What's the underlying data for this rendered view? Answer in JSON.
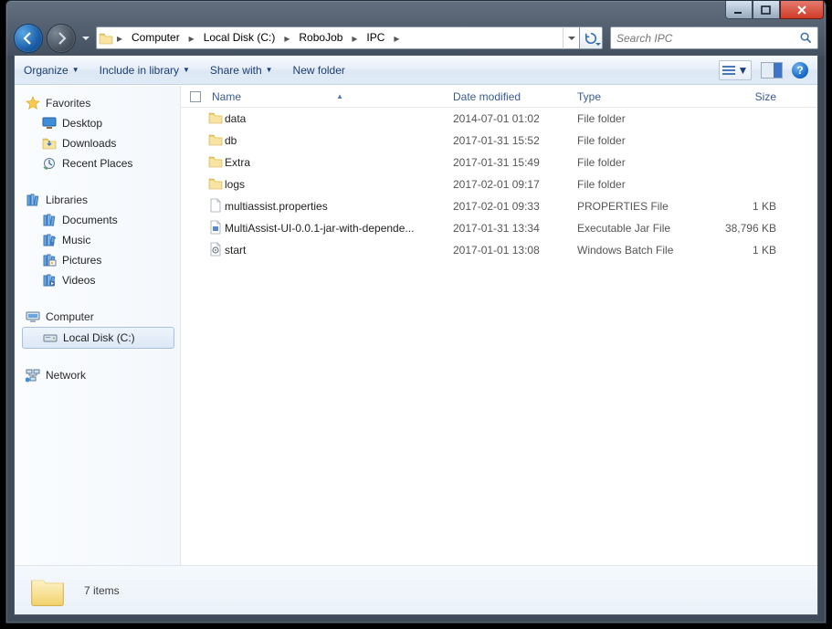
{
  "window": {
    "min_tip": "Minimize",
    "max_tip": "Maximize",
    "close_tip": "Close"
  },
  "nav": {
    "back_tip": "Back",
    "forward_tip": "Forward"
  },
  "breadcrumbs": [
    "Computer",
    "Local Disk (C:)",
    "RoboJob",
    "IPC"
  ],
  "search": {
    "placeholder": "Search IPC"
  },
  "toolbar": {
    "organize": "Organize",
    "include": "Include in library",
    "share": "Share with",
    "new_folder": "New folder"
  },
  "sidebar": {
    "favorites": {
      "label": "Favorites",
      "items": [
        "Desktop",
        "Downloads",
        "Recent Places"
      ]
    },
    "libraries": {
      "label": "Libraries",
      "items": [
        "Documents",
        "Music",
        "Pictures",
        "Videos"
      ]
    },
    "computer": {
      "label": "Computer",
      "items": [
        "Local Disk (C:)"
      ]
    },
    "network": {
      "label": "Network"
    }
  },
  "columns": {
    "name": "Name",
    "date": "Date modified",
    "type": "Type",
    "size": "Size"
  },
  "files": [
    {
      "icon": "folder",
      "name": "data",
      "date": "2014-07-01 01:02",
      "type": "File folder",
      "size": ""
    },
    {
      "icon": "folder",
      "name": "db",
      "date": "2017-01-31 15:52",
      "type": "File folder",
      "size": ""
    },
    {
      "icon": "folder",
      "name": "Extra",
      "date": "2017-01-31 15:49",
      "type": "File folder",
      "size": ""
    },
    {
      "icon": "folder",
      "name": "logs",
      "date": "2017-02-01 09:17",
      "type": "File folder",
      "size": ""
    },
    {
      "icon": "file",
      "name": "multiassist.properties",
      "date": "2017-02-01 09:33",
      "type": "PROPERTIES File",
      "size": "1 KB"
    },
    {
      "icon": "jar",
      "name": "MultiAssist-UI-0.0.1-jar-with-depende...",
      "date": "2017-01-31 13:34",
      "type": "Executable Jar File",
      "size": "38,796 KB"
    },
    {
      "icon": "batch",
      "name": "start",
      "date": "2017-01-01 13:08",
      "type": "Windows Batch File",
      "size": "1 KB"
    }
  ],
  "details": {
    "summary": "7 items"
  }
}
